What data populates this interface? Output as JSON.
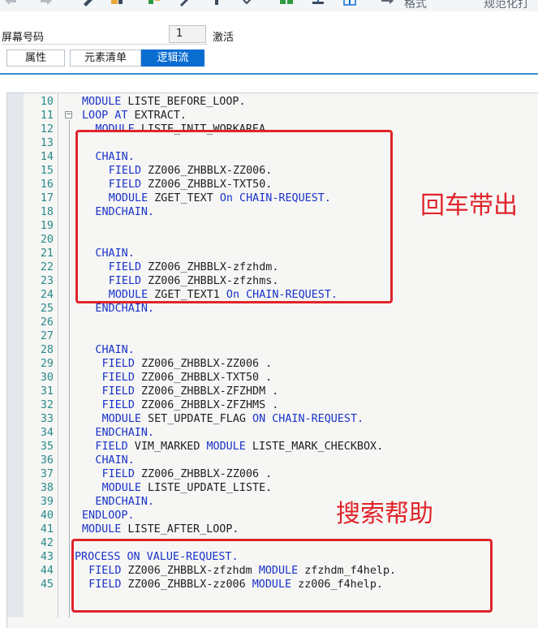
{
  "toolbar": {
    "format_label": "格式",
    "right_label": "规范化打"
  },
  "screen": {
    "label": "屏幕号码",
    "value": "1",
    "status": "激活"
  },
  "tabs": [
    {
      "label": "属性",
      "active": false
    },
    {
      "label": "元素清单",
      "active": false
    },
    {
      "label": "逻辑流",
      "active": true
    }
  ],
  "code_lines": [
    {
      "num": "10",
      "indent": 1,
      "parts": [
        [
          "kw",
          "MODULE"
        ],
        [
          "t",
          " LISTE_BEFORE_LOOP."
        ]
      ]
    },
    {
      "num": "11",
      "indent": 1,
      "parts": [
        [
          "kw",
          "LOOP AT"
        ],
        [
          "t",
          " EXTRACT."
        ]
      ]
    },
    {
      "num": "12",
      "indent": 3,
      "parts": [
        [
          "kw",
          "MODULE"
        ],
        [
          "t",
          " LISTE_INIT_WORKAREA."
        ]
      ]
    },
    {
      "num": "13",
      "indent": 0,
      "parts": []
    },
    {
      "num": "14",
      "indent": 3,
      "parts": [
        [
          "kw",
          "CHAIN."
        ]
      ]
    },
    {
      "num": "15",
      "indent": 5,
      "parts": [
        [
          "kw",
          "FIELD"
        ],
        [
          "t",
          " ZZ006_ZHBBLX-ZZ006."
        ]
      ]
    },
    {
      "num": "16",
      "indent": 5,
      "parts": [
        [
          "kw",
          "FIELD"
        ],
        [
          "t",
          " ZZ006_ZHBBLX-TXT50."
        ]
      ]
    },
    {
      "num": "17",
      "indent": 5,
      "parts": [
        [
          "kw",
          "MODULE"
        ],
        [
          "t",
          " ZGET_TEXT "
        ],
        [
          "kw",
          "On CHAIN-REQUEST."
        ]
      ]
    },
    {
      "num": "18",
      "indent": 3,
      "parts": [
        [
          "kw",
          "ENDCHAIN."
        ]
      ]
    },
    {
      "num": "19",
      "indent": 0,
      "parts": []
    },
    {
      "num": "20",
      "indent": 0,
      "parts": []
    },
    {
      "num": "21",
      "indent": 3,
      "parts": [
        [
          "kw",
          "CHAIN."
        ]
      ]
    },
    {
      "num": "22",
      "indent": 5,
      "parts": [
        [
          "kw",
          "FIELD"
        ],
        [
          "t",
          " ZZ006_ZHBBLX-zfzhdm."
        ]
      ]
    },
    {
      "num": "23",
      "indent": 5,
      "parts": [
        [
          "kw",
          "FIELD"
        ],
        [
          "t",
          " ZZ006_ZHBBLX-zfzhms."
        ]
      ]
    },
    {
      "num": "24",
      "indent": 5,
      "parts": [
        [
          "kw",
          "MODULE"
        ],
        [
          "t",
          " ZGET_TEXT1 "
        ],
        [
          "kw",
          "On CHAIN-REQUEST."
        ]
      ]
    },
    {
      "num": "25",
      "indent": 3,
      "parts": [
        [
          "kw",
          "ENDCHAIN."
        ]
      ]
    },
    {
      "num": "26",
      "indent": 0,
      "parts": []
    },
    {
      "num": "27",
      "indent": 0,
      "parts": []
    },
    {
      "num": "28",
      "indent": 3,
      "parts": [
        [
          "kw",
          "CHAIN."
        ]
      ]
    },
    {
      "num": "29",
      "indent": 4,
      "parts": [
        [
          "kw",
          "FIELD"
        ],
        [
          "t",
          " ZZ006_ZHBBLX-ZZ006 ."
        ]
      ]
    },
    {
      "num": "30",
      "indent": 4,
      "parts": [
        [
          "kw",
          "FIELD"
        ],
        [
          "t",
          " ZZ006_ZHBBLX-TXT50 ."
        ]
      ]
    },
    {
      "num": "31",
      "indent": 4,
      "parts": [
        [
          "kw",
          "FIELD"
        ],
        [
          "t",
          " ZZ006_ZHBBLX-ZFZHDM ."
        ]
      ]
    },
    {
      "num": "32",
      "indent": 4,
      "parts": [
        [
          "kw",
          "FIELD"
        ],
        [
          "t",
          " ZZ006_ZHBBLX-ZFZHMS ."
        ]
      ]
    },
    {
      "num": "33",
      "indent": 4,
      "parts": [
        [
          "kw",
          "MODULE"
        ],
        [
          "t",
          " SET_UPDATE_FLAG "
        ],
        [
          "kw",
          "ON CHAIN-REQUEST."
        ]
      ]
    },
    {
      "num": "34",
      "indent": 3,
      "parts": [
        [
          "kw",
          "ENDCHAIN."
        ]
      ]
    },
    {
      "num": "35",
      "indent": 3,
      "parts": [
        [
          "kw",
          "FIELD"
        ],
        [
          "t",
          " VIM_MARKED "
        ],
        [
          "kw",
          "MODULE"
        ],
        [
          "t",
          " LISTE_MARK_CHECKBOX."
        ]
      ]
    },
    {
      "num": "36",
      "indent": 3,
      "parts": [
        [
          "kw",
          "CHAIN."
        ]
      ]
    },
    {
      "num": "37",
      "indent": 4,
      "parts": [
        [
          "kw",
          "FIELD"
        ],
        [
          "t",
          " ZZ006_ZHBBLX-ZZ006 ."
        ]
      ]
    },
    {
      "num": "38",
      "indent": 4,
      "parts": [
        [
          "kw",
          "MODULE"
        ],
        [
          "t",
          " LISTE_UPDATE_LISTE."
        ]
      ]
    },
    {
      "num": "39",
      "indent": 3,
      "parts": [
        [
          "kw",
          "ENDCHAIN."
        ]
      ]
    },
    {
      "num": "40",
      "indent": 1,
      "parts": [
        [
          "kw",
          "ENDLOOP."
        ]
      ]
    },
    {
      "num": "41",
      "indent": 1,
      "parts": [
        [
          "kw",
          "MODULE"
        ],
        [
          "t",
          " LISTE_AFTER_LOOP."
        ]
      ]
    },
    {
      "num": "42",
      "indent": 0,
      "parts": []
    },
    {
      "num": "43",
      "indent": 0,
      "parts": [
        [
          "kw",
          "PROCESS ON VALUE-REQUEST."
        ]
      ]
    },
    {
      "num": "44",
      "indent": 2,
      "parts": [
        [
          "kw",
          "FIELD"
        ],
        [
          "t",
          " ZZ006_ZHBBLX-zfzhdm "
        ],
        [
          "kw",
          "MODULE"
        ],
        [
          "t",
          " zfzhdm_f4help."
        ]
      ]
    },
    {
      "num": "45",
      "indent": 2,
      "parts": [
        [
          "kw",
          "FIELD"
        ],
        [
          "t",
          " ZZ006_ZHBBLX-zz006 "
        ],
        [
          "kw",
          "MODULE"
        ],
        [
          "t",
          " zz006_f4help."
        ]
      ]
    }
  ],
  "annotations": {
    "enter_out": "回车带出",
    "search_help": "搜索帮助"
  },
  "colors": {
    "keyword": "#1a32c8",
    "line_number": "#2b8a8a",
    "annotation_red": "#e0242a",
    "tab_active": "#0a6ed1"
  }
}
